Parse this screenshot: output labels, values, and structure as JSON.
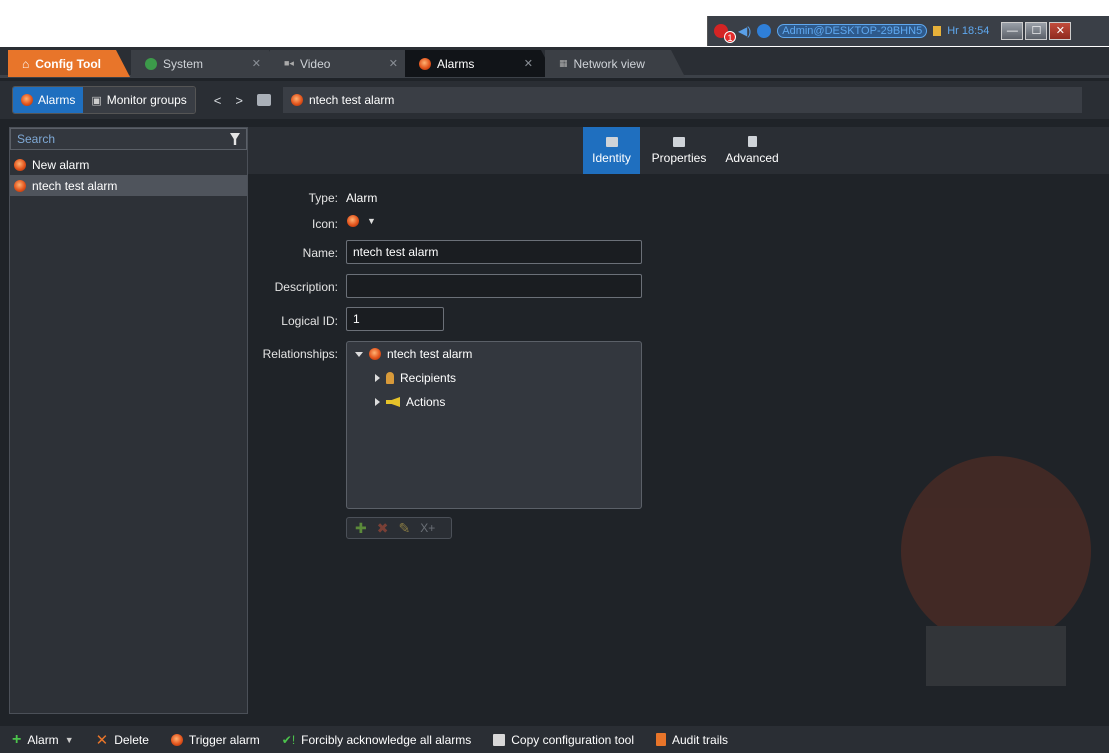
{
  "system_tray": {
    "notification_count": "1",
    "user_label": "Admin@DESKTOP-29BHN5",
    "time_label": "Hr 18:54"
  },
  "tabs": [
    {
      "label": "Config Tool"
    },
    {
      "label": "System"
    },
    {
      "label": "Video"
    },
    {
      "label": "Alarms"
    },
    {
      "label": "Network view"
    }
  ],
  "navbar": {
    "alarms_label": "Alarms",
    "monitor_groups_label": "Monitor groups",
    "breadcrumb": "ntech test alarm"
  },
  "left_panel": {
    "search_placeholder": "Search",
    "items": [
      {
        "label": "New alarm"
      },
      {
        "label": "ntech test alarm"
      }
    ]
  },
  "page_tabs": [
    {
      "label": "Identity"
    },
    {
      "label": "Properties"
    },
    {
      "label": "Advanced"
    }
  ],
  "identity": {
    "type_label": "Type:",
    "type_value": "Alarm",
    "icon_label": "Icon:",
    "name_label": "Name:",
    "name_value": "ntech test alarm",
    "description_label": "Description:",
    "description_value": "",
    "logical_id_label": "Logical ID:",
    "logical_id_value": "1",
    "relationships_label": "Relationships:",
    "relationships": {
      "root": "ntech test alarm",
      "children": [
        "Recipients",
        "Actions"
      ]
    }
  },
  "bottom_bar": {
    "alarm": "Alarm",
    "delete": "Delete",
    "trigger": "Trigger alarm",
    "acknowledge": "Forcibly acknowledge all alarms",
    "copy": "Copy configuration tool",
    "audit": "Audit trails"
  },
  "colors": {
    "accent_blue": "#1f6fbf",
    "config_orange": "#e8752a",
    "background": "#1f2328"
  }
}
